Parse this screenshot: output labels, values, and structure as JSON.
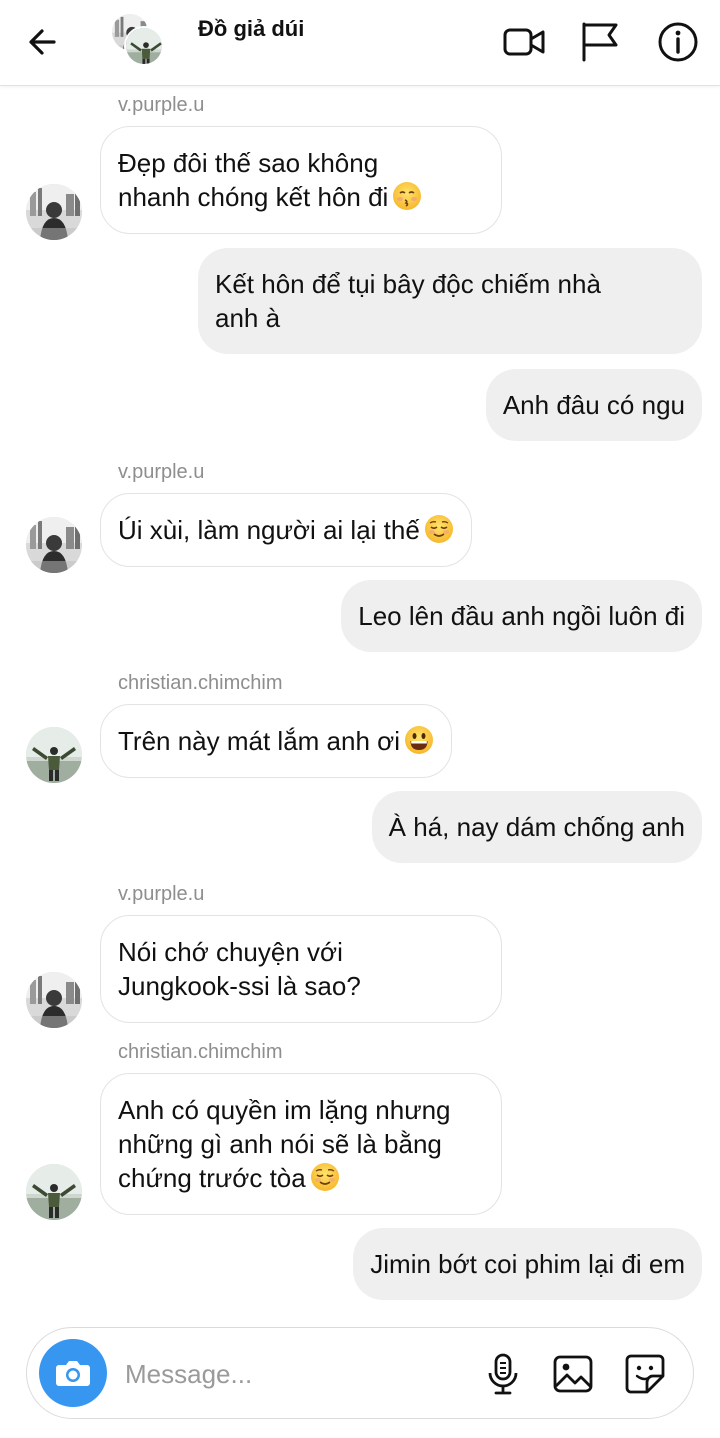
{
  "header": {
    "title": "Đồ giả dúi",
    "icons": [
      "back-arrow-icon",
      "video-call-icon",
      "flag-icon",
      "info-icon"
    ]
  },
  "messages": [
    {
      "side": "in",
      "sender": "v.purple.u",
      "lines": [
        "Đẹp đôi thế sao không",
        "nhanh chóng kết hôn đi"
      ],
      "emoji": "kissing-face-emoji"
    },
    {
      "side": "out",
      "lines": [
        "Kết hôn để tụi bây độc chiếm nhà",
        "anh à"
      ]
    },
    {
      "side": "out",
      "lines": [
        "Anh đâu có ngu"
      ]
    },
    {
      "side": "in",
      "sender": "v.purple.u",
      "lines": [
        "Úi xùi, làm người ai lại thế"
      ],
      "emoji": "relieved-face-emoji"
    },
    {
      "side": "out",
      "lines": [
        "Leo lên đầu anh ngồi luôn đi"
      ]
    },
    {
      "side": "in",
      "sender": "christian.chimchim",
      "lines": [
        "Trên này mát lắm anh ơi"
      ],
      "emoji": "grinning-face-emoji"
    },
    {
      "side": "out",
      "lines": [
        "À há, nay dám chống anh"
      ]
    },
    {
      "side": "in",
      "sender": "v.purple.u",
      "lines": [
        "Nói chớ chuyện với",
        "Jungkook-ssi là sao?"
      ]
    },
    {
      "side": "in",
      "sender": "christian.chimchim",
      "lines": [
        "Anh có quyền im lặng nhưng",
        "những gì anh nói sẽ là bằng",
        "chứng trước tòa"
      ],
      "emoji": "relieved-face-emoji"
    },
    {
      "side": "out",
      "lines": [
        "Jimin bớt coi phim lại đi em"
      ]
    }
  ],
  "composer": {
    "placeholder": "Message...",
    "icons": [
      "camera-icon",
      "microphone-icon",
      "gallery-icon",
      "sticker-icon"
    ]
  },
  "colors": {
    "accent": "#3797f0",
    "outgoing_bubble": "#efefef",
    "incoming_border": "#e3e3e3",
    "sender_text": "#8e8e8e"
  }
}
